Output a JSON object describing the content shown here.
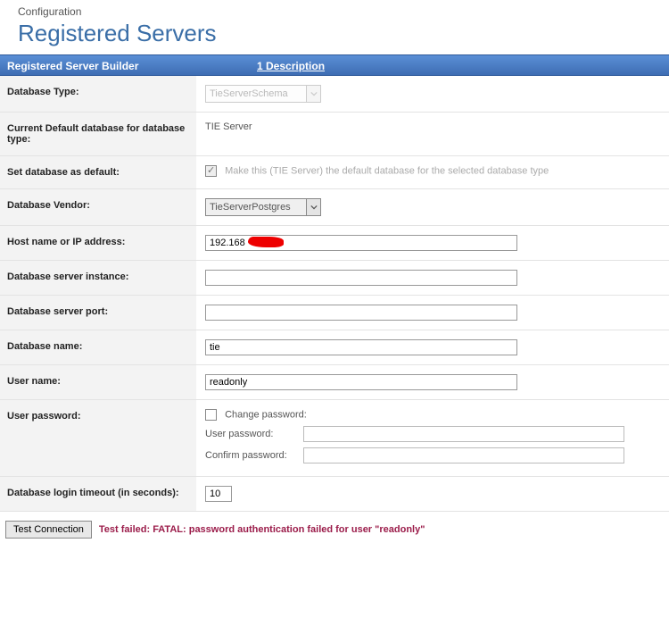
{
  "header": {
    "breadcrumb": "Configuration",
    "title": "Registered Servers"
  },
  "tabs": {
    "builder": "Registered Server Builder",
    "description": "1 Description"
  },
  "labels": {
    "databaseType": "Database Type:",
    "currentDefault": "Current Default database for database type:",
    "setDefault": "Set database as default:",
    "vendor": "Database Vendor:",
    "host": "Host name or IP address:",
    "instance": "Database server instance:",
    "port": "Database server port:",
    "dbName": "Database name:",
    "userName": "User name:",
    "userPassword": "User password:",
    "changePassword": "Change password:",
    "pwUser": "User password:",
    "pwConfirm": "Confirm password:",
    "timeout": "Database login timeout (in seconds):"
  },
  "values": {
    "databaseType": "TieServerSchema",
    "currentDefault": "TIE Server",
    "setDefaultText": "Make this (TIE Server) the default database for the selected database type",
    "vendor": "TieServerPostgres",
    "host": "192.168",
    "instance": "",
    "port": "",
    "dbName": "tie",
    "userName": "readonly",
    "pwUser": "",
    "pwConfirm": "",
    "timeout": "10"
  },
  "footer": {
    "testButton": "Test Connection",
    "error": "Test failed: FATAL: password authentication failed for user \"readonly\""
  }
}
